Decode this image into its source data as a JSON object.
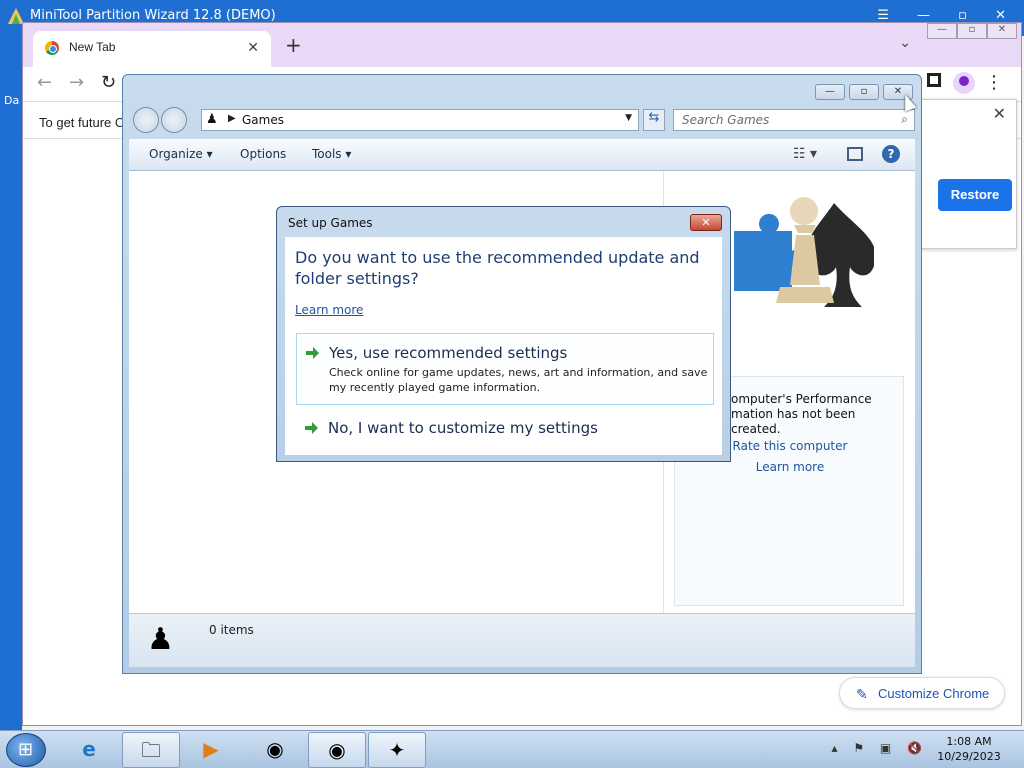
{
  "bg_app": {
    "title": "MiniTool Partition Wizard 12.8 (DEMO)",
    "side_text": "Da"
  },
  "chrome": {
    "tab_label": "New Tab",
    "infobar_text": "To get future C",
    "restore_label": "Restore",
    "customize_label": "Customize Chrome"
  },
  "explorer": {
    "address": "Games",
    "search_placeholder": "Search Games",
    "menu": {
      "organize": "Organize",
      "options": "Options",
      "tools": "Tools"
    },
    "perf_text_line1": "omputer's Performance",
    "perf_text_line2": "mation has not been created.",
    "rate_link": "Rate this computer",
    "learn_more": "Learn more",
    "items_count": "0 items"
  },
  "dialog": {
    "title": "Set up Games",
    "question": "Do you want to use the recommended update and folder settings?",
    "learn_more": "Learn more",
    "option_recommended": {
      "title": "Yes, use recommended settings",
      "desc": "Check online for game updates, news, art and information, and save my recently played game information."
    },
    "option_custom": {
      "title": "No, I want to customize my settings"
    }
  },
  "taskbar": {
    "time": "1:08 AM",
    "date": "10/29/2023"
  },
  "colors": {
    "accent": "#1a73e8",
    "link": "#1e56a0",
    "arrow_green": "#2e9e3a"
  }
}
